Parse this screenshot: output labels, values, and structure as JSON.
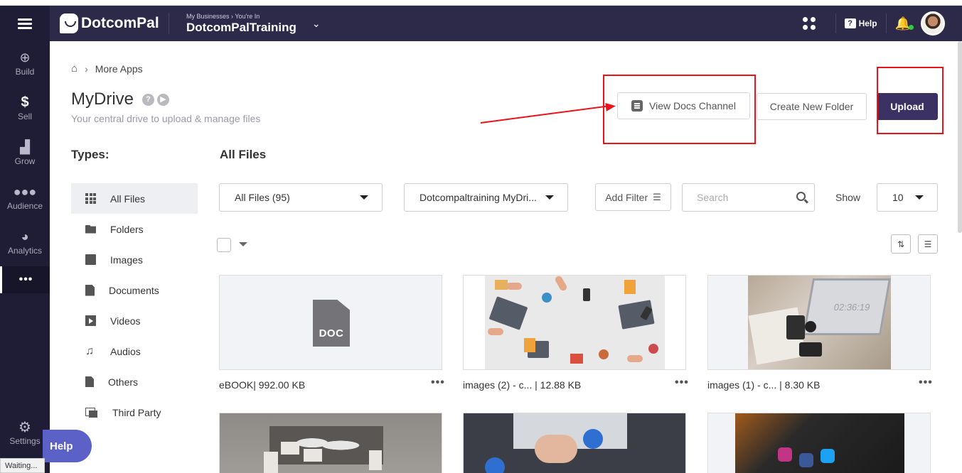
{
  "brand": {
    "name": "DotcomPal"
  },
  "business": {
    "label": "My Businesses › You're In",
    "name": "DotcomPalTraining"
  },
  "topbar": {
    "help": "Help"
  },
  "rail": {
    "items": [
      {
        "label": "Build",
        "icon": "plus-circle-icon"
      },
      {
        "label": "Sell",
        "icon": "dollar-icon"
      },
      {
        "label": "Grow",
        "icon": "growth-icon"
      },
      {
        "label": "Audience",
        "icon": "people-icon"
      },
      {
        "label": "Analytics",
        "icon": "pie-icon"
      }
    ],
    "more": "•••",
    "settings": "Settings"
  },
  "breadcrumb": {
    "current": "More Apps"
  },
  "page": {
    "title": "MyDrive",
    "subtitle": "Your central drive to upload & manage files"
  },
  "actions": {
    "view_docs": "View Docs Channel",
    "create_folder": "Create New Folder",
    "upload": "Upload"
  },
  "types": {
    "heading": "Types:",
    "items": [
      {
        "label": "All Files",
        "icon": "grid-icon"
      },
      {
        "label": "Folders",
        "icon": "folder-icon"
      },
      {
        "label": "Images",
        "icon": "image-icon"
      },
      {
        "label": "Documents",
        "icon": "document-icon"
      },
      {
        "label": "Videos",
        "icon": "video-icon"
      },
      {
        "label": "Audios",
        "icon": "music-icon"
      },
      {
        "label": "Others",
        "icon": "file-icon"
      },
      {
        "label": "Third Party",
        "icon": "third-party-icon"
      }
    ]
  },
  "files": {
    "heading": "All Files",
    "filter_type": "All Files (95)",
    "drive_select": "Dotcompaltraining MyDri...",
    "add_filter": "Add Filter",
    "search_placeholder": "Search",
    "show_label": "Show",
    "show_value": "10",
    "cards": [
      {
        "caption": "eBOOK| 992.00 KB",
        "kind": "doc",
        "doc_label": "DOC"
      },
      {
        "caption": "images (2) - c... | 12.88 KB",
        "kind": "image"
      },
      {
        "caption": "images (1) - c... | 8.30 KB",
        "kind": "image",
        "clock_text": "02:36:19"
      }
    ],
    "more_menu": "•••"
  },
  "help_float": "Help",
  "status": "Waiting..."
}
